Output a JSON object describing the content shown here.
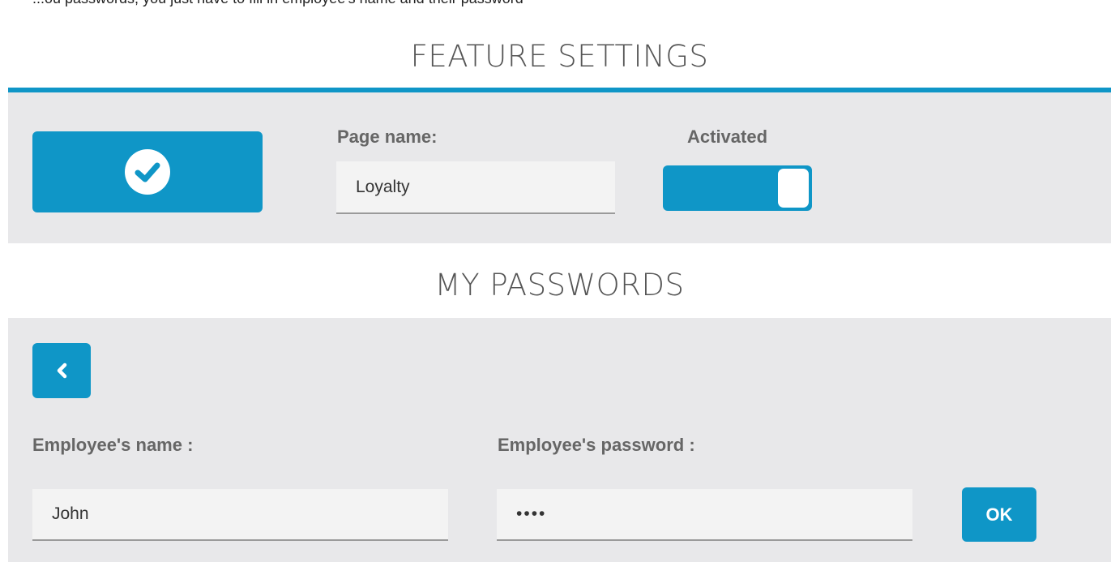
{
  "top_clipped_text": "...ou passwords, you just have to fill in employee's name and their password",
  "feature_settings": {
    "title": "FEATURE SETTINGS",
    "page_name_label": "Page name:",
    "page_name_value": "Loyalty",
    "activated_label": "Activated",
    "activated": true,
    "confirm_icon": "check-circle-icon"
  },
  "my_passwords": {
    "title": "MY PASSWORDS",
    "back_icon": "chevron-left-icon",
    "employee_name_label": "Employee's name :",
    "employee_name_value": "John",
    "employee_password_label": "Employee's password :",
    "employee_password_value": "••••",
    "ok_label": "OK"
  },
  "colors": {
    "accent": "#0f96c7",
    "panel_bg": "#e8e8ea",
    "input_bg": "#f3f3f3",
    "label_text": "#666666",
    "title_text": "#555555"
  }
}
